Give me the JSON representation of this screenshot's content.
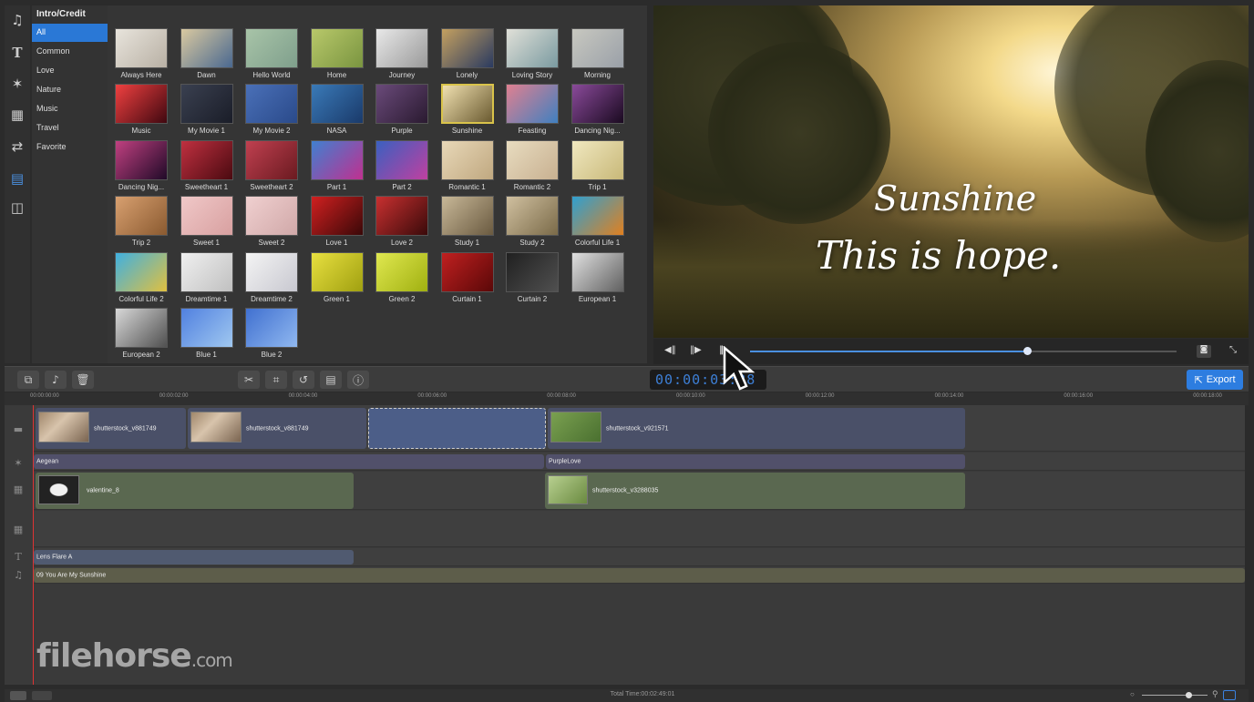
{
  "sidebar": {
    "title": "Intro/Credit",
    "categories": [
      "All",
      "Common",
      "Love",
      "Nature",
      "Music",
      "Travel",
      "Favorite"
    ]
  },
  "icons": [
    "music-icon",
    "text-icon",
    "magic-wand-icon",
    "overlay-icon",
    "transition-icon",
    "intro-credit-icon",
    "split-screen-icon"
  ],
  "templates": [
    {
      "label": "Always Here",
      "c1": "#e8e4dc",
      "c2": "#b8b0a4"
    },
    {
      "label": "Dawn",
      "c1": "#d9c9a0",
      "c2": "#4a6890"
    },
    {
      "label": "Hello World",
      "c1": "#a8c4a8",
      "c2": "#7f9f8c"
    },
    {
      "label": "Home",
      "c1": "#b8c86a",
      "c2": "#7a9540"
    },
    {
      "label": "Journey",
      "c1": "#e8e8e8",
      "c2": "#9a9a9a"
    },
    {
      "label": "Lonely",
      "c1": "#c4a060",
      "c2": "#2a3a60"
    },
    {
      "label": "Loving Story",
      "c1": "#e0e0d8",
      "c2": "#7a9aa0"
    },
    {
      "label": "Morning",
      "c1": "#c8c8c0",
      "c2": "#9aa0a8"
    },
    {
      "label": "Music",
      "c1": "#f04040",
      "c2": "#400810"
    },
    {
      "label": "My Movie 1",
      "c1": "#3a4050",
      "c2": "#1a1d28"
    },
    {
      "label": "My Movie 2",
      "c1": "#4a70b8",
      "c2": "#2a4a8a"
    },
    {
      "label": "NASA",
      "c1": "#3a7ab8",
      "c2": "#1a3a6a"
    },
    {
      "label": "Purple",
      "c1": "#6a4a7a",
      "c2": "#2a1a30"
    },
    {
      "label": "Sunshine",
      "c1": "#f0e0b0",
      "c2": "#6a5a30"
    },
    {
      "label": "Feasting",
      "c1": "#e08090",
      "c2": "#4080c0"
    },
    {
      "label": "Dancing Nig...",
      "c1": "#8a4a9a",
      "c2": "#1a0a20"
    },
    {
      "label": "Dancing Nig...",
      "c1": "#c04080",
      "c2": "#200a28"
    },
    {
      "label": "Sweetheart 1",
      "c1": "#c03040",
      "c2": "#4a0a10"
    },
    {
      "label": "Sweetheart 2",
      "c1": "#c04050",
      "c2": "#6a1a20"
    },
    {
      "label": "Part 1",
      "c1": "#4080d0",
      "c2": "#c03090"
    },
    {
      "label": "Part 2",
      "c1": "#3a60c0",
      "c2": "#c040a0"
    },
    {
      "label": "Romantic 1",
      "c1": "#e8d8b8",
      "c2": "#c0a880"
    },
    {
      "label": "Romantic 2",
      "c1": "#e8dcc0",
      "c2": "#c8b090"
    },
    {
      "label": "Trip 1",
      "c1": "#f0e8c0",
      "c2": "#c8b878"
    },
    {
      "label": "Trip 2",
      "c1": "#d8a070",
      "c2": "#8a5a30"
    },
    {
      "label": "Sweet 1",
      "c1": "#f0c8c8",
      "c2": "#d8a0a0"
    },
    {
      "label": "Sweet 2",
      "c1": "#f0d0d0",
      "c2": "#d0a8a8"
    },
    {
      "label": "Love 1",
      "c1": "#d02020",
      "c2": "#3a0808"
    },
    {
      "label": "Love 2",
      "c1": "#c83030",
      "c2": "#3a0a0a"
    },
    {
      "label": "Study 1",
      "c1": "#c8b898",
      "c2": "#6a5a40"
    },
    {
      "label": "Study 2",
      "c1": "#d0c0a0",
      "c2": "#7a6a48"
    },
    {
      "label": "Colorful Life 1",
      "c1": "#30a0d0",
      "c2": "#e08020"
    },
    {
      "label": "Colorful Life 2",
      "c1": "#40b0e0",
      "c2": "#e0c040"
    },
    {
      "label": "Dreamtime 1",
      "c1": "#f0f0f0",
      "c2": "#c0c0c0"
    },
    {
      "label": "Dreamtime 2",
      "c1": "#f4f4f4",
      "c2": "#c8c8d0"
    },
    {
      "label": "Green 1",
      "c1": "#e8e040",
      "c2": "#a0a010"
    },
    {
      "label": "Green 2",
      "c1": "#e0e850",
      "c2": "#a0b010"
    },
    {
      "label": "Curtain 1",
      "c1": "#c02020",
      "c2": "#5a0808"
    },
    {
      "label": "Curtain 2",
      "c1": "#202020",
      "c2": "#505050"
    },
    {
      "label": "European 1",
      "c1": "#e0e0e0",
      "c2": "#606060"
    },
    {
      "label": "European 2",
      "c1": "#d8d8d8",
      "c2": "#505050"
    },
    {
      "label": "Blue 1",
      "c1": "#5080e0",
      "c2": "#a0c8f0"
    },
    {
      "label": "Blue 2",
      "c1": "#4070d0",
      "c2": "#90b8f0"
    }
  ],
  "preview": {
    "line1": "Sunshine",
    "line2": "This is hope."
  },
  "toolbar": {
    "timecode": "00:00:03:28",
    "export_label": "Export"
  },
  "ruler": [
    "00:00:00:00",
    "00:00:02:00",
    "00:00:04:00",
    "00:00:06:00",
    "00:00:08:00",
    "00:00:10:00",
    "00:00:12:00",
    "00:00:14:00",
    "00:00:16:00",
    "00:00:18:00"
  ],
  "tracks": {
    "video": [
      "shutterstock_v881749",
      "shutterstock_v881749",
      "shutterstock_v921571"
    ],
    "transitions": [
      "Aegean",
      "PurpleLove"
    ],
    "overlay": [
      "valentine_8",
      "shutterstock_v3288035"
    ],
    "text": "Lens Flare A",
    "audio": "09 You Are My Sunshine"
  },
  "status": {
    "total_time": "Total Time:00:02:49:01"
  },
  "watermark": {
    "main": "filehorse",
    "suffix": ".com"
  }
}
